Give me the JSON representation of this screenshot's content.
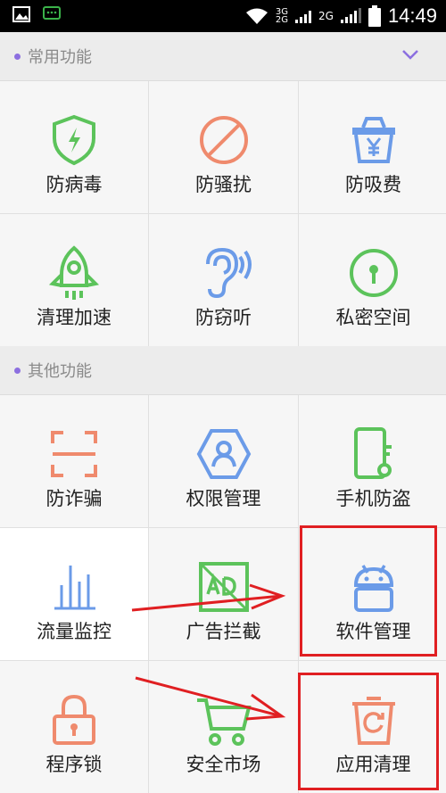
{
  "status": {
    "net1": "3G",
    "net2": "2G",
    "net3": "2G",
    "time": "14:49"
  },
  "sections": {
    "common": {
      "title": "常用功能"
    },
    "other": {
      "title": "其他功能"
    }
  },
  "common_items": [
    {
      "label": "防病毒",
      "icon": "shield-bolt-icon",
      "color": "#5cc35b"
    },
    {
      "label": "防骚扰",
      "icon": "no-entry-icon",
      "color": "#ef8a6d"
    },
    {
      "label": "防吸费",
      "icon": "yuan-basket-icon",
      "color": "#6b9be8"
    },
    {
      "label": "清理加速",
      "icon": "rocket-icon",
      "color": "#5cc35b"
    },
    {
      "label": "防窃听",
      "icon": "ear-icon",
      "color": "#6b9be8"
    },
    {
      "label": "私密空间",
      "icon": "lock-circle-icon",
      "color": "#5cc35b"
    }
  ],
  "other_items": [
    {
      "label": "防诈骗",
      "icon": "scan-frame-icon",
      "color": "#ef8a6d"
    },
    {
      "label": "权限管理",
      "icon": "user-hexagon-icon",
      "color": "#6b9be8"
    },
    {
      "label": "手机防盗",
      "icon": "phone-key-icon",
      "color": "#5cc35b"
    },
    {
      "label": "流量监控",
      "icon": "bar-chart-icon",
      "color": "#6b9be8"
    },
    {
      "label": "广告拦截",
      "icon": "ad-block-icon",
      "color": "#5cc35b"
    },
    {
      "label": "软件管理",
      "icon": "android-icon",
      "color": "#6b9be8"
    },
    {
      "label": "程序锁",
      "icon": "padlock-icon",
      "color": "#ef8a6d"
    },
    {
      "label": "安全市场",
      "icon": "cart-icon",
      "color": "#5cc35b"
    },
    {
      "label": "应用清理",
      "icon": "recycle-bin-icon",
      "color": "#ef8a6d"
    }
  ]
}
